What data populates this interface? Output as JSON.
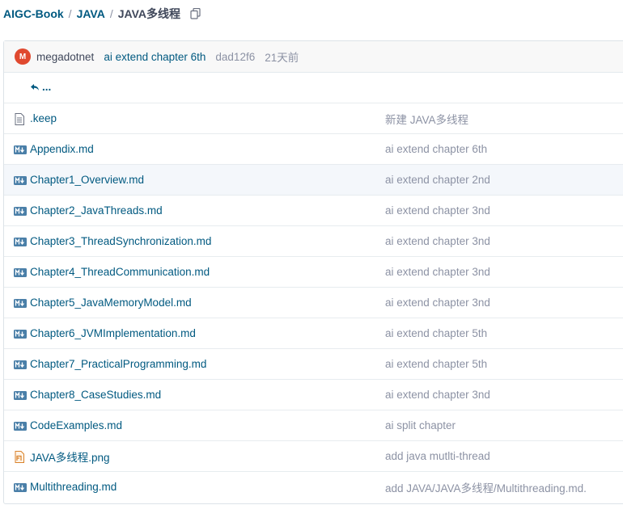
{
  "breadcrumb": {
    "items": [
      "AIGC-Book",
      "JAVA"
    ],
    "current": "JAVA多线程",
    "separator": "/"
  },
  "commit": {
    "avatar_letter": "M",
    "author": "megadotnet",
    "message": "ai extend chapter 6th",
    "sha": "dad12f6",
    "time": "21天前"
  },
  "back": {
    "label": "..."
  },
  "files": [
    {
      "icon": "file-text-icon",
      "name": ".keep",
      "message": "新建 JAVA多线程"
    },
    {
      "icon": "markdown-icon",
      "name": "Appendix.md",
      "message": "ai extend chapter 6th"
    },
    {
      "icon": "markdown-icon",
      "name": "Chapter1_Overview.md",
      "message": "ai extend chapter 2nd"
    },
    {
      "icon": "markdown-icon",
      "name": "Chapter2_JavaThreads.md",
      "message": "ai extend chapter 3nd"
    },
    {
      "icon": "markdown-icon",
      "name": "Chapter3_ThreadSynchronization.md",
      "message": "ai extend chapter 3nd"
    },
    {
      "icon": "markdown-icon",
      "name": "Chapter4_ThreadCommunication.md",
      "message": "ai extend chapter 3nd"
    },
    {
      "icon": "markdown-icon",
      "name": "Chapter5_JavaMemoryModel.md",
      "message": "ai extend chapter 3nd"
    },
    {
      "icon": "markdown-icon",
      "name": "Chapter6_JVMImplementation.md",
      "message": "ai extend chapter 5th"
    },
    {
      "icon": "markdown-icon",
      "name": "Chapter7_PracticalProgramming.md",
      "message": "ai extend chapter 5th"
    },
    {
      "icon": "markdown-icon",
      "name": "Chapter8_CaseStudies.md",
      "message": "ai extend chapter 3nd"
    },
    {
      "icon": "markdown-icon",
      "name": "CodeExamples.md",
      "message": "ai split chapter"
    },
    {
      "icon": "image-file-icon",
      "name": "JAVA多线程.png",
      "message": "add java mutlti-thread"
    },
    {
      "icon": "markdown-icon",
      "name": "Multithreading.md",
      "message": "add JAVA/JAVA多线程/Multithreading.md."
    }
  ],
  "colors": {
    "link": "#005980",
    "muted": "#8c92a4",
    "avatar": "#e0492f",
    "row_highlight": "#f4f7fb"
  }
}
